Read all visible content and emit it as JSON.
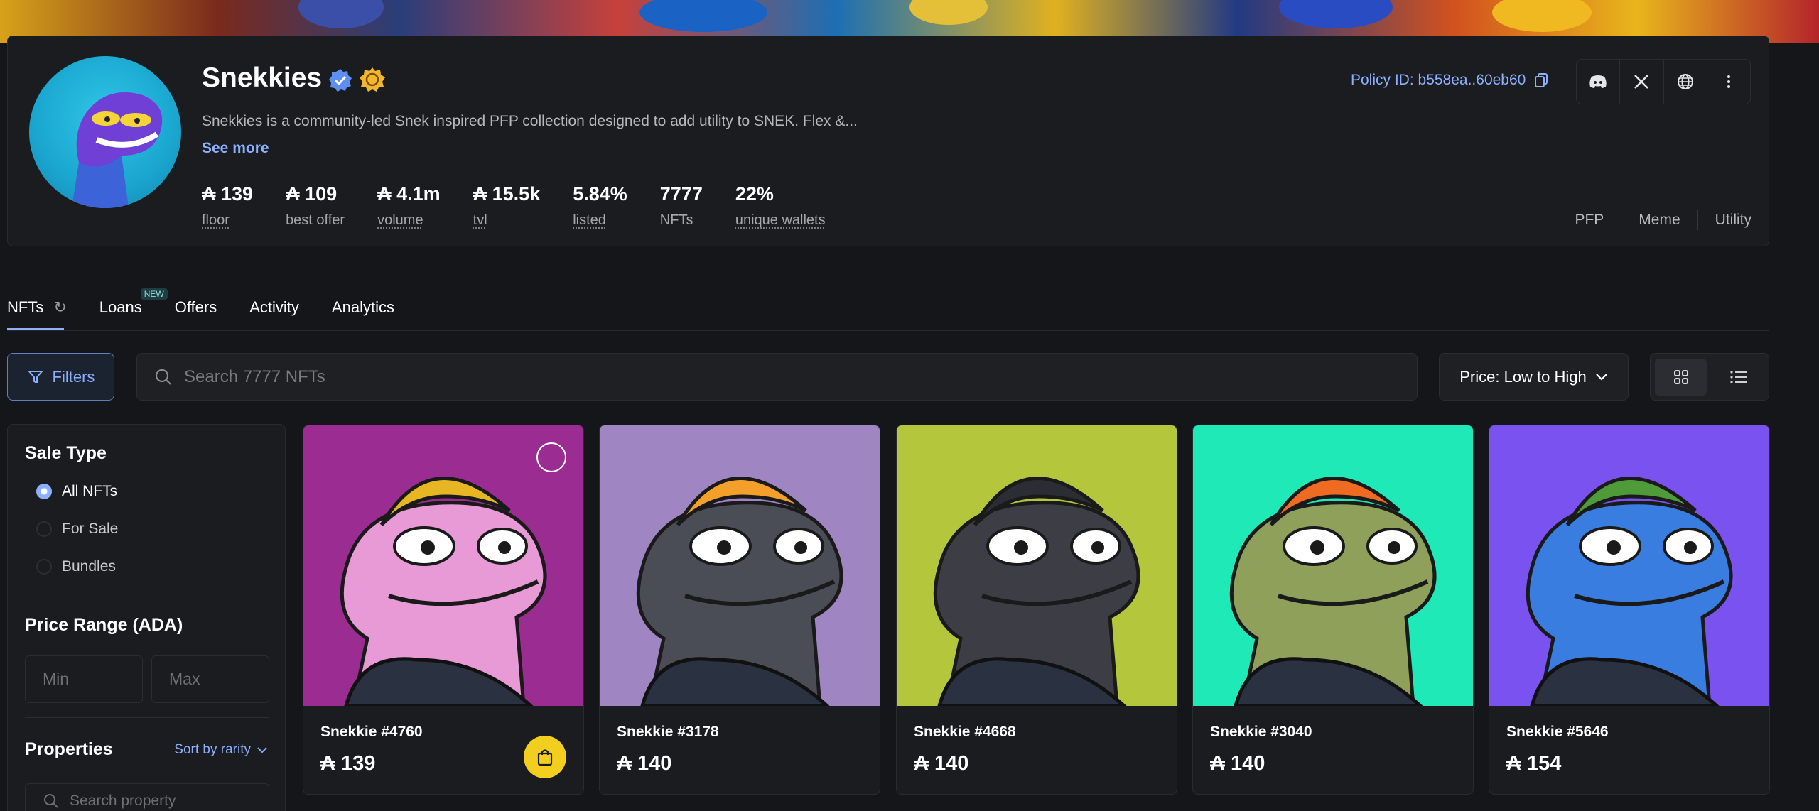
{
  "collection": {
    "name": "Snekkies",
    "description": "Snekkies is a community-led Snek inspired PFP collection designed to add utility to SNEK. Flex &...",
    "see_more": "See more",
    "policy_id": "Policy ID: b558ea..60eb60",
    "stats": [
      {
        "value": "₳ 139",
        "label": "floor"
      },
      {
        "value": "₳ 109",
        "label": "best offer"
      },
      {
        "value": "₳ 4.1m",
        "label": "volume"
      },
      {
        "value": "₳ 15.5k",
        "label": "tvl"
      },
      {
        "value": "5.84%",
        "label": "listed"
      },
      {
        "value": "7777",
        "label": "NFTs"
      },
      {
        "value": "22%",
        "label": "unique wallets"
      }
    ],
    "tags": [
      "PFP",
      "Meme",
      "Utility"
    ]
  },
  "tabs": [
    {
      "label": "NFTs"
    },
    {
      "label": "Loans",
      "badge": "NEW"
    },
    {
      "label": "Offers"
    },
    {
      "label": "Activity"
    },
    {
      "label": "Analytics"
    }
  ],
  "toolbar": {
    "filters_label": "Filters",
    "search_placeholder": "Search 7777 NFTs",
    "sort_label": "Price: Low to High"
  },
  "sidebar": {
    "sale_type_title": "Sale Type",
    "sale_options": [
      "All NFTs",
      "For Sale",
      "Bundles"
    ],
    "selected_sale_option": "All NFTs",
    "price_range_title": "Price Range (ADA)",
    "min_placeholder": "Min",
    "max_placeholder": "Max",
    "properties_title": "Properties",
    "sort_by_rarity": "Sort by rarity",
    "search_property_placeholder": "Search property"
  },
  "nfts": [
    {
      "name": "Snekkie #4760",
      "price": "₳ 139",
      "bg": "#9a2c92",
      "skin": "#e79ad6",
      "hat": "#e7b623"
    },
    {
      "name": "Snekkie #3178",
      "price": "₳ 140",
      "bg": "#9f86c2",
      "skin": "#4a4d55",
      "hat": "#f2a02a"
    },
    {
      "name": "Snekkie #4668",
      "price": "₳ 140",
      "bg": "#b4c73c",
      "skin": "#3d3d46",
      "hat": "#2c2c34"
    },
    {
      "name": "Snekkie #3040",
      "price": "₳ 140",
      "bg": "#1ee9b7",
      "skin": "#8fa05a",
      "hat": "#ef6b22"
    },
    {
      "name": "Snekkie #5646",
      "price": "₳ 154",
      "bg": "#7a52f0",
      "skin": "#3a7de0",
      "hat": "#4f9b3a"
    }
  ],
  "colors": {
    "accent": "#8bb0ff",
    "buy": "#f2cf1e",
    "background": "#15161a",
    "card": "#1b1c20"
  }
}
